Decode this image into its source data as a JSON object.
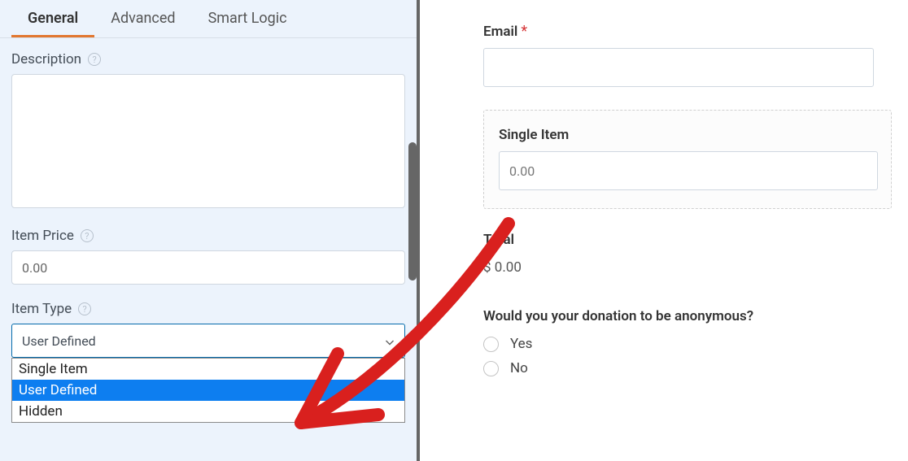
{
  "sidebar": {
    "tabs": [
      "General",
      "Advanced",
      "Smart Logic"
    ],
    "description": {
      "label": "Description",
      "value": ""
    },
    "item_price": {
      "label": "Item Price",
      "value": "0.00"
    },
    "item_type": {
      "label": "Item Type",
      "selected": "User Defined",
      "options": [
        "Single Item",
        "User Defined",
        "Hidden"
      ]
    }
  },
  "preview": {
    "email_label": "Email",
    "single_item_label": "Single Item",
    "single_item_value": "0.00",
    "total_label": "Total",
    "total_value": "$ 0.00",
    "anon_question": "Would you your donation to be anonymous?",
    "anon_options": [
      "Yes",
      "No"
    ]
  }
}
